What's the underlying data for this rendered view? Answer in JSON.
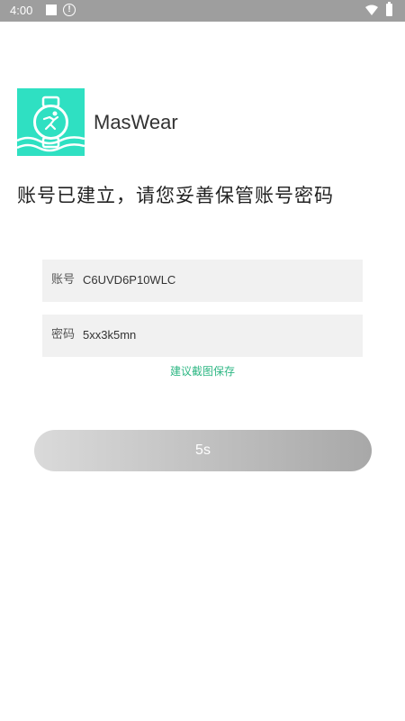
{
  "status_bar": {
    "time": "4:00",
    "icons": [
      "stop-square-icon",
      "alert-circle-icon",
      "wifi-icon",
      "battery-icon"
    ]
  },
  "app": {
    "name": "MasWear",
    "logo_icon": "smartwatch-runner-logo",
    "brand_color": "#2FE0C2"
  },
  "headline": "账号已建立，请您妥善保管账号密码",
  "account": {
    "label": "账号",
    "value": "C6UVD6P10WLC"
  },
  "password": {
    "label": "密码",
    "value": "5xx3k5mn"
  },
  "hint": "建议截图保存",
  "countdown_button": {
    "label": "5s"
  },
  "colors": {
    "hint_green": "#2FB784",
    "field_bg": "#F1F1F1",
    "status_bar": "#9E9E9E"
  }
}
